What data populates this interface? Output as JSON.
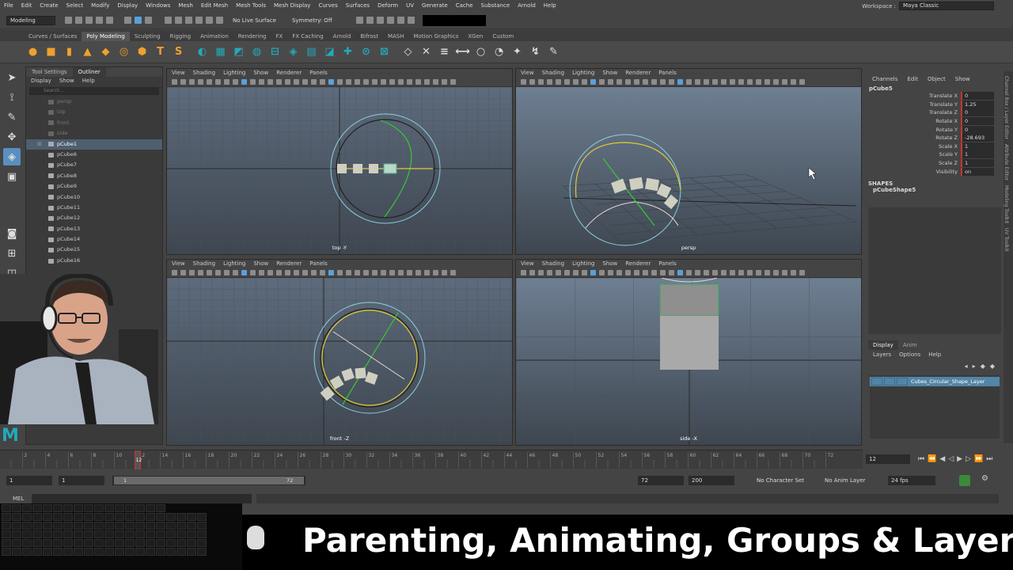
{
  "menubar": {
    "items": [
      "File",
      "Edit",
      "Create",
      "Select",
      "Modify",
      "Display",
      "Windows",
      "Mesh",
      "Edit Mesh",
      "Mesh Tools",
      "Mesh Display",
      "Curves",
      "Surfaces",
      "Deform",
      "UV",
      "Generate",
      "Cache",
      "Substance",
      "Arnold",
      "Help"
    ],
    "workspace_label": "Workspace :",
    "workspace_value": "Maya Classic"
  },
  "statusline": {
    "mode": "Modeling",
    "live_surface": "No Live Surface",
    "symmetry": "Symmetry: Off"
  },
  "shelf": {
    "tabs": [
      "Curves / Surfaces",
      "Poly Modeling",
      "Sculpting",
      "Rigging",
      "Animation",
      "Rendering",
      "FX",
      "FX Caching",
      "Arnold",
      "Bifrost",
      "MASH",
      "Motion Graphics",
      "XGen",
      "Custom"
    ],
    "active_tab": "Poly Modeling",
    "icons": [
      "sphere",
      "cube",
      "cylinder",
      "cone",
      "plane",
      "torus",
      "svg-t",
      "text",
      "svg",
      "combine",
      "separate",
      "extract",
      "smooth",
      "bridge",
      "bevel",
      "extrude",
      "fill",
      "multicut",
      "target-weld",
      "connect",
      "quad-draw",
      "insert-edge",
      "offset-edge",
      "mirror",
      "circularize",
      "wedge",
      "poke",
      "transfer",
      "crease"
    ]
  },
  "outliner": {
    "tabs": [
      "Tool Settings",
      "Outliner"
    ],
    "active_tab": "Outliner",
    "menu": [
      "Display",
      "Show",
      "Help"
    ],
    "search_placeholder": "Search...",
    "items": [
      {
        "name": "persp",
        "dim": true
      },
      {
        "name": "top",
        "dim": true
      },
      {
        "name": "front",
        "dim": true
      },
      {
        "name": "side",
        "dim": true
      },
      {
        "name": "pCube1",
        "dim": false,
        "selected": true,
        "expandable": true
      },
      {
        "name": "pCube6",
        "dim": false
      },
      {
        "name": "pCube7",
        "dim": false
      },
      {
        "name": "pCube8",
        "dim": false
      },
      {
        "name": "pCube9",
        "dim": false
      },
      {
        "name": "pCube10",
        "dim": false
      },
      {
        "name": "pCube11",
        "dim": false
      },
      {
        "name": "pCube12",
        "dim": false
      },
      {
        "name": "pCube13",
        "dim": false
      },
      {
        "name": "pCube14",
        "dim": false
      },
      {
        "name": "pCube15",
        "dim": false
      },
      {
        "name": "pCube16",
        "dim": false
      }
    ]
  },
  "viewports": [
    {
      "label": "top -Y",
      "menu": [
        "View",
        "Shading",
        "Lighting",
        "Show",
        "Renderer",
        "Panels"
      ]
    },
    {
      "label": "persp",
      "menu": [
        "View",
        "Shading",
        "Lighting",
        "Show",
        "Renderer",
        "Panels"
      ]
    },
    {
      "label": "front -Z",
      "menu": [
        "View",
        "Shading",
        "Lighting",
        "Show",
        "Renderer",
        "Panels"
      ]
    },
    {
      "label": "side -X",
      "menu": [
        "View",
        "Shading",
        "Lighting",
        "Show",
        "Renderer",
        "Panels"
      ]
    }
  ],
  "channelbox": {
    "menu": [
      "Channels",
      "Edit",
      "Object",
      "Show"
    ],
    "object": "pCube5",
    "attributes": [
      {
        "label": "Translate X",
        "value": "0"
      },
      {
        "label": "Translate Y",
        "value": "1.25"
      },
      {
        "label": "Translate Z",
        "value": "0"
      },
      {
        "label": "Rotate X",
        "value": "0"
      },
      {
        "label": "Rotate Y",
        "value": "0"
      },
      {
        "label": "Rotate Z",
        "value": "-28.693"
      },
      {
        "label": "Scale X",
        "value": "1"
      },
      {
        "label": "Scale Y",
        "value": "1"
      },
      {
        "label": "Scale Z",
        "value": "1"
      },
      {
        "label": "Visibility",
        "value": "on"
      }
    ],
    "shapes_header": "SHAPES",
    "shape_name": "pCubeShape5"
  },
  "side_tabs": [
    "Channel Box / Layer Editor",
    "Attribute Editor",
    "Modeling Toolkit",
    "UV Toolkit"
  ],
  "layers": {
    "tabs": [
      "Display",
      "Anim"
    ],
    "active_tab": "Display",
    "menu": [
      "Layers",
      "Options",
      "Help"
    ],
    "layer_name": "Cubes_Circular_Shape_Layer"
  },
  "timeline": {
    "ticks": [
      "2",
      "4",
      "6",
      "8",
      "10",
      "12",
      "14",
      "16",
      "18",
      "20",
      "22",
      "24",
      "26",
      "28",
      "30",
      "32",
      "34",
      "36",
      "38",
      "40",
      "42",
      "44",
      "46",
      "48",
      "50",
      "52",
      "54",
      "56",
      "58",
      "60",
      "62",
      "64",
      "66",
      "68",
      "70",
      "72"
    ],
    "current_frame": "12",
    "current_frame_field": "12"
  },
  "range": {
    "start": "1",
    "anim_start": "1",
    "slider_start": "1",
    "slider_end": "72",
    "end": "72",
    "anim_end": "200",
    "character_set": "No Character Set",
    "anim_layer": "No Anim Layer",
    "fps": "24 fps"
  },
  "cmdline": {
    "label": "MEL"
  },
  "banner": {
    "title": "Parenting, Animating, Groups & Layers"
  },
  "colors": {
    "accent": "#5aa0d8",
    "selection": "#4e5f70",
    "layer": "#5285a6",
    "shelf_orange": "#f0a030",
    "maya_teal": "#22aabb"
  }
}
